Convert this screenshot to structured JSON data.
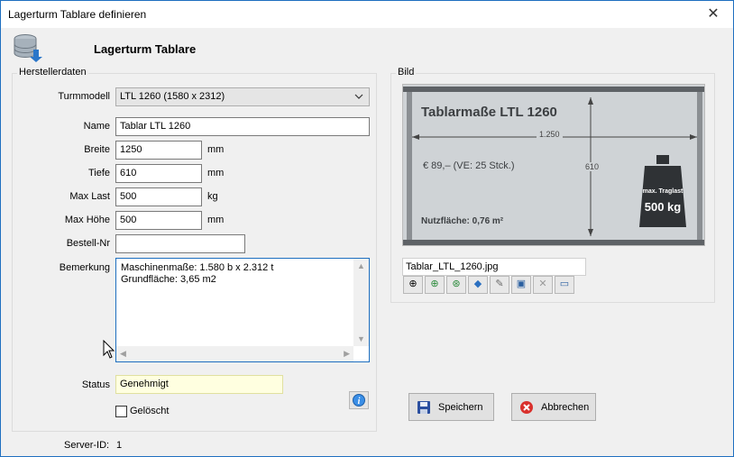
{
  "window": {
    "title": "Lagerturm Tablare definieren"
  },
  "header": {
    "title": "Lagerturm Tablare"
  },
  "manufacturer": {
    "group_label": "Herstellerdaten",
    "turmmodell_label": "Turmmodell",
    "turmmodell_value": "LTL 1260 (1580 x 2312)",
    "name_label": "Name",
    "name_value": "Tablar LTL 1260",
    "breite_label": "Breite",
    "breite_value": "1250",
    "breite_unit": "mm",
    "tiefe_label": "Tiefe",
    "tiefe_value": "610",
    "tiefe_unit": "mm",
    "maxlast_label": "Max Last",
    "maxlast_value": "500",
    "maxlast_unit": "kg",
    "maxhoehe_label": "Max Höhe",
    "maxhoehe_value": "500",
    "maxhoehe_unit": "mm",
    "bestellnr_label": "Bestell-Nr",
    "bestellnr_value": "",
    "bemerkung_label": "Bemerkung",
    "bemerkung_lines": [
      "Maschinenmaße: 1.580 b x 2.312 t",
      "Grundfläche: 3,65 m2"
    ],
    "status_label": "Status",
    "status_value": "Genehmigt",
    "geloescht_label": "Gelöscht",
    "geloescht_checked": false
  },
  "server": {
    "label": "Server-ID:",
    "value": "1"
  },
  "picture": {
    "group_label": "Bild",
    "image_title": "Tablarmaße LTL 1260",
    "width_label": "1.250",
    "depth_label": "610",
    "price_text": "€ 89,– (VE: 25 Stck.)",
    "area_text": "Nutzfläche: 0,76 m²",
    "weight_line1": "max. Traglast",
    "weight_line2": "500 kg",
    "filename": "Tablar_LTL_1260.jpg",
    "toolbar_icons": [
      "binoculars-icon",
      "add-icon",
      "scan-icon",
      "paint-icon",
      "wrench-icon",
      "camera-icon",
      "delete-icon",
      "monitor-icon"
    ]
  },
  "buttons": {
    "save_label": "Speichern",
    "cancel_label": "Abbrechen"
  },
  "colors": {
    "accent": "#1e6fc0",
    "status_bg": "#ffffe0",
    "picture_bg": "#cfd3d6",
    "cancel_red": "#d9302c",
    "save_blue": "#2b4fa0"
  }
}
